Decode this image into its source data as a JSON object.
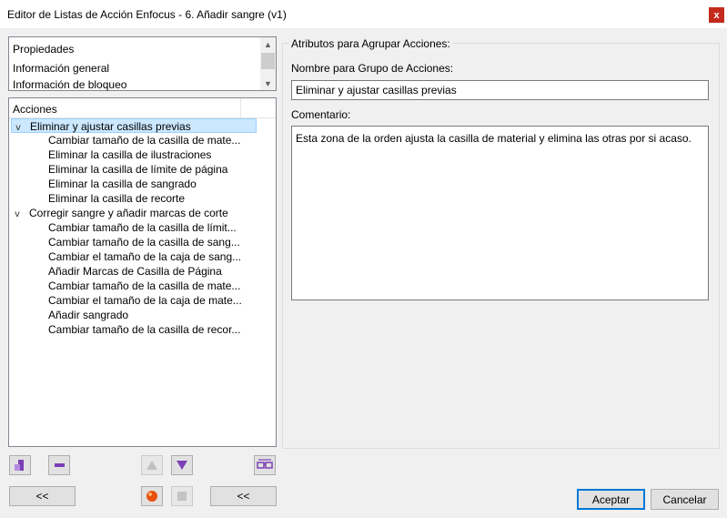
{
  "window": {
    "title": "Editor de Listas de Acción Enfocus - 6. Añadir sangre (v1)",
    "close_label": "x"
  },
  "properties": {
    "items": [
      "Propiedades",
      "Información general",
      "Información de bloqueo"
    ]
  },
  "tree": {
    "header": "Acciones",
    "groups": [
      {
        "label": "Eliminar y ajustar casillas previas",
        "expanded": true,
        "selected": true,
        "children": [
          "Cambiar tamaño de la casilla de mate...",
          "Eliminar la casilla de ilustraciones",
          "Eliminar la casilla de límite de página",
          "Eliminar la casilla de sangrado",
          "Eliminar la casilla de recorte"
        ]
      },
      {
        "label": "Corregir sangre y añadir marcas de corte",
        "expanded": true,
        "selected": false,
        "children": [
          "Cambiar tamaño de la casilla de límit...",
          "Cambiar tamaño de la casilla de sang...",
          "Cambiar el tamaño de la caja de sang...",
          "Añadir Marcas de Casilla de Página",
          "Cambiar tamaño de la casilla de mate...",
          "Cambiar el tamaño de la caja de mate...",
          "Añadir sangrado",
          "Cambiar tamaño de la casilla de recor..."
        ]
      }
    ]
  },
  "attributes": {
    "section_title": "Atributos para Agrupar Acciones:",
    "name_label": "Nombre para Grupo de Acciones:",
    "name_value": "Eliminar y ajustar casillas previas",
    "comment_label": "Comentario:",
    "comment_value": "Esta zona de la orden ajusta la casilla de material y elimina las otras por si acaso."
  },
  "toolbar": {
    "add_icon": "add-action-icon",
    "remove_icon": "remove-action-icon",
    "up_icon": "triangle-up-icon",
    "down_icon": "triangle-down-icon",
    "glasses_icon": "glasses-icon",
    "record_icon": "record-icon",
    "stop_icon": "stop-icon",
    "collapse_left_label": "<<",
    "collapse_right_label": "<<"
  },
  "footer": {
    "ok_label": "Aceptar",
    "cancel_label": "Cancelar"
  },
  "colors": {
    "selection": "#cce8ff",
    "accent": "#0078d7",
    "close": "#c42b1c",
    "icon_purple": "#7b3fb5"
  }
}
